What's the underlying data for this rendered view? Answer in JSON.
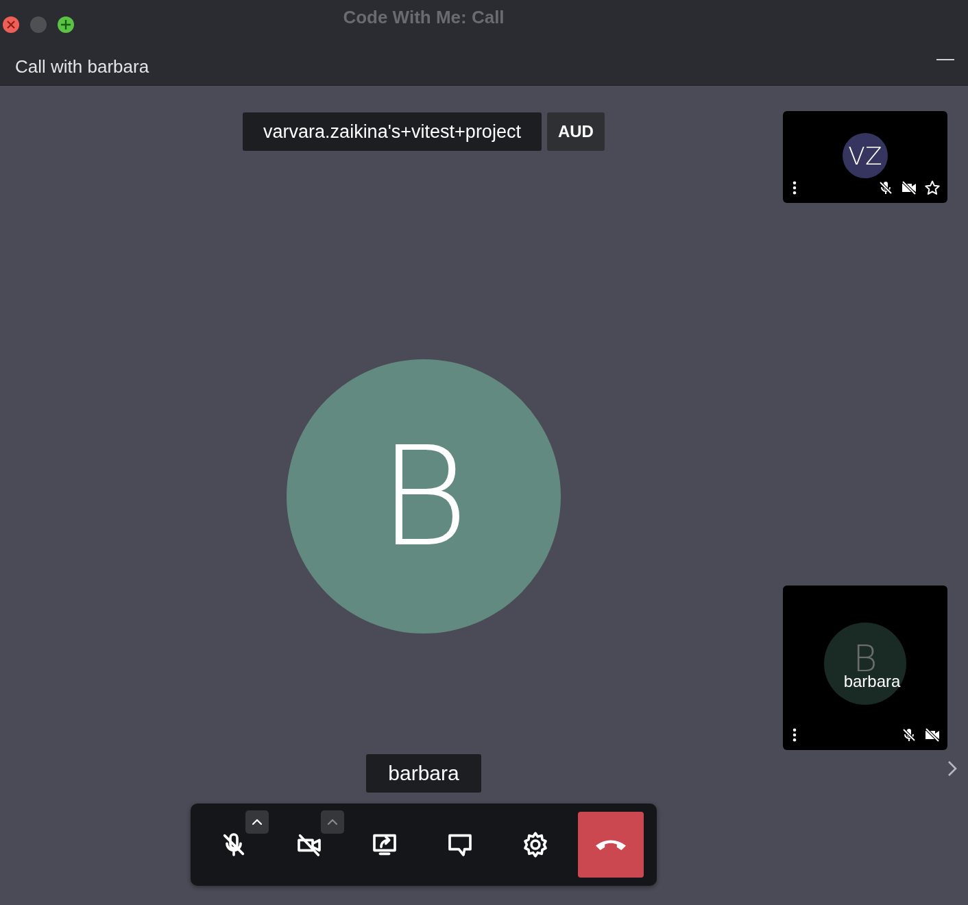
{
  "window": {
    "title": "Code With Me: Call"
  },
  "header": {
    "title": "Call with barbara"
  },
  "meeting": {
    "name": "varvara.zaikina's+vitest+project",
    "badge": "AUD"
  },
  "speaker": {
    "letter": "B",
    "color": "#638a80",
    "name": "barbara"
  },
  "thumbnails": [
    {
      "letter": "VZ",
      "color": "#35355f",
      "mic_muted": true,
      "camera_off": true,
      "favorite": false
    },
    {
      "letter": "B",
      "color": "#1a2a24",
      "label": "barbara",
      "mic_muted": true,
      "camera_off": true
    }
  ],
  "toolbar": [
    {
      "kind": "mic",
      "off": true,
      "menu": {
        "disabled": false
      }
    },
    {
      "kind": "camera",
      "off": true,
      "menu": {
        "disabled": true
      }
    },
    {
      "kind": "share"
    },
    {
      "kind": "chat"
    },
    {
      "kind": "settings"
    },
    {
      "kind": "hangup"
    }
  ]
}
